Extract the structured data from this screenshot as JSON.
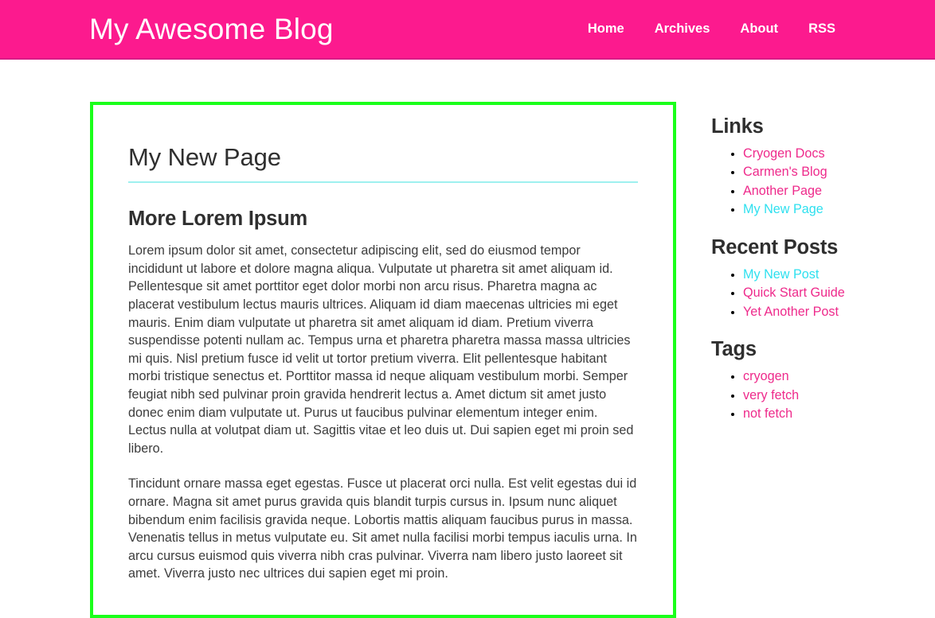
{
  "header": {
    "site_title": "My Awesome Blog",
    "nav": [
      {
        "label": "Home"
      },
      {
        "label": "Archives"
      },
      {
        "label": "About"
      },
      {
        "label": "RSS"
      }
    ]
  },
  "main": {
    "page_title": "My New Page",
    "section_title": "More Lorem Ipsum",
    "paragraphs": [
      "Lorem ipsum dolor sit amet, consectetur adipiscing elit, sed do eiusmod tempor incididunt ut labore et dolore magna aliqua. Vulputate ut pharetra sit amet aliquam id. Pellentesque sit amet porttitor eget dolor morbi non arcu risus. Pharetra magna ac placerat vestibulum lectus mauris ultrices. Aliquam id diam maecenas ultricies mi eget mauris. Enim diam vulputate ut pharetra sit amet aliquam id diam. Pretium viverra suspendisse potenti nullam ac. Tempus urna et pharetra pharetra massa massa ultricies mi quis. Nisl pretium fusce id velit ut tortor pretium viverra. Elit pellentesque habitant morbi tristique senectus et. Porttitor massa id neque aliquam vestibulum morbi. Semper feugiat nibh sed pulvinar proin gravida hendrerit lectus a. Amet dictum sit amet justo donec enim diam vulputate ut. Purus ut faucibus pulvinar elementum integer enim. Lectus nulla at volutpat diam ut. Sagittis vitae et leo duis ut. Dui sapien eget mi proin sed libero.",
      "Tincidunt ornare massa eget egestas. Fusce ut placerat orci nulla. Est velit egestas dui id ornare. Magna sit amet purus gravida quis blandit turpis cursus in. Ipsum nunc aliquet bibendum enim facilisis gravida neque. Lobortis mattis aliquam faucibus purus in massa. Venenatis tellus in metus vulputate eu. Sit amet nulla facilisi morbi tempus iaculis urna. In arcu cursus euismod quis viverra nibh cras pulvinar. Viverra nam libero justo laoreet sit amet. Viverra justo nec ultrices dui sapien eget mi proin."
    ]
  },
  "sidebar": {
    "links": {
      "heading": "Links",
      "items": [
        {
          "label": "Cryogen Docs",
          "state": "default"
        },
        {
          "label": "Carmen's Blog",
          "state": "default"
        },
        {
          "label": "Another Page",
          "state": "default"
        },
        {
          "label": "My New Page",
          "state": "visited"
        }
      ]
    },
    "recent_posts": {
      "heading": "Recent Posts",
      "items": [
        {
          "label": "My New Post",
          "state": "visited"
        },
        {
          "label": "Quick Start Guide",
          "state": "default"
        },
        {
          "label": "Yet Another Post",
          "state": "default"
        }
      ]
    },
    "tags": {
      "heading": "Tags",
      "items": [
        {
          "label": "cryogen",
          "state": "default"
        },
        {
          "label": "very fetch",
          "state": "default"
        },
        {
          "label": "not fetch",
          "state": "default"
        }
      ]
    }
  },
  "colors": {
    "header_background": "#fc1a8e",
    "header_border": "#d81b86",
    "content_border": "#1aff1a",
    "title_rule": "#9ef0ef",
    "link_default": "#ee2a8b",
    "link_visited": "#2ee0ef",
    "heading_text": "#2f2f2f",
    "body_text": "#3c3c3c"
  }
}
